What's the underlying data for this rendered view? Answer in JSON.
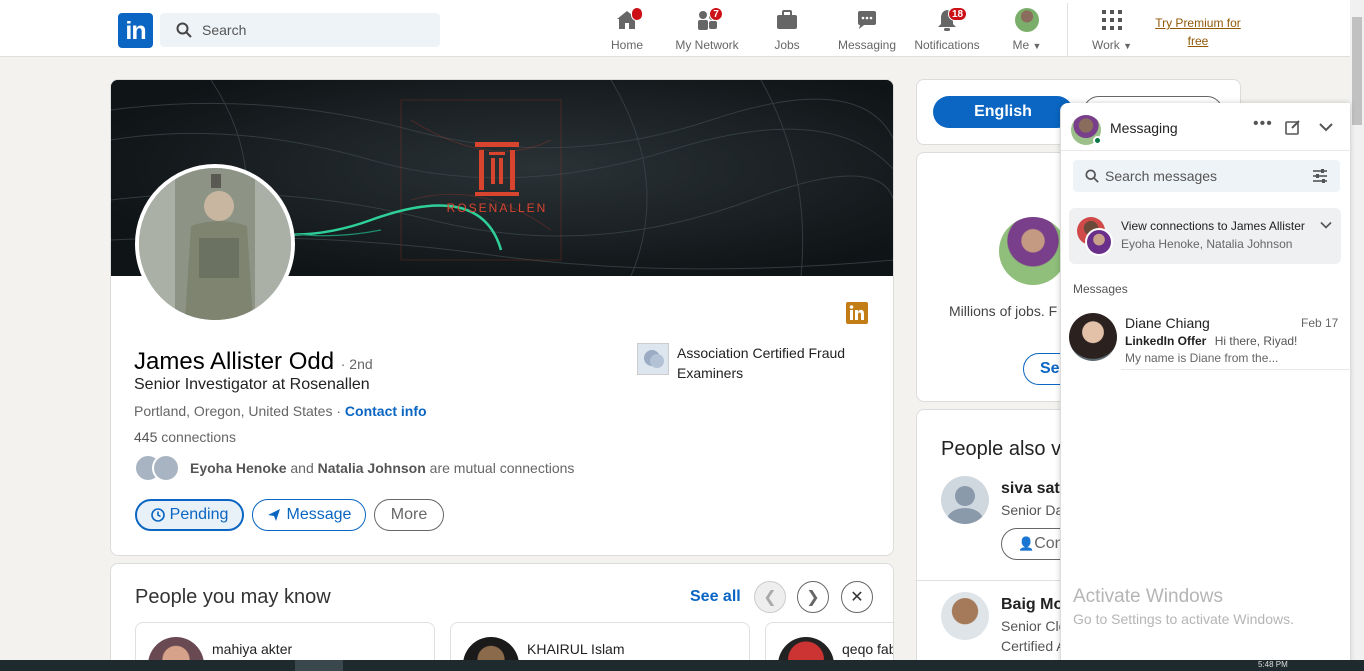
{
  "nav": {
    "search_placeholder": "Search",
    "items": [
      {
        "label": "Home",
        "badge": ""
      },
      {
        "label": "My Network",
        "badge": "7"
      },
      {
        "label": "Jobs",
        "badge": ""
      },
      {
        "label": "Messaging",
        "badge": ""
      },
      {
        "label": "Notifications",
        "badge": "18"
      },
      {
        "label": "Me",
        "badge": ""
      },
      {
        "label": "Work",
        "badge": ""
      }
    ],
    "premium_line1": "Try Premium for",
    "premium_line2": "free"
  },
  "profile": {
    "banner_text": "ROSENALLEN",
    "name": "James Allister Odd",
    "degree": "· 2nd",
    "headline": "Senior Investigator at Rosenallen",
    "location": "Portland, Oregon, United States",
    "location_sep": " · ",
    "contact_info": "Contact info",
    "connections_count": "445",
    "connections_label": " connections",
    "mutual_1": "Eyoha Henoke",
    "mutual_and": " and ",
    "mutual_2": "Natalia Johnson",
    "mutual_suffix": " are mutual connections",
    "school": "Association Certified Fraud Examiners",
    "buttons": {
      "pending": "Pending",
      "message": "Message",
      "more": "More"
    }
  },
  "pymk": {
    "title": "People you may know",
    "see_all": "See all",
    "people": [
      "mahiya akter",
      "KHAIRUL Islam",
      "qeqo fab"
    ]
  },
  "right": {
    "language": "English",
    "ad_text": "Millions of jobs. F",
    "ad_btn": "Sea",
    "pav_title": "People also vi",
    "pav": [
      {
        "name": "siva saty",
        "title": "Senior Da",
        "btn": "Con"
      },
      {
        "name": "Baig Mo",
        "title": "Senior Clo",
        "title2": "Certified A"
      }
    ]
  },
  "messaging": {
    "title": "Messaging",
    "search_placeholder": "Search messages",
    "view_conn_title": "View connections to James Allister",
    "view_conn_sub": "Eyoha Henoke, Natalia Johnson",
    "messages_label": "Messages",
    "convo": {
      "name": "Diane Chiang",
      "date": "Feb 17",
      "tag": "LinkedIn Offer",
      "preview1": "Hi there, Riyad!",
      "preview2": "My name is Diane from the..."
    }
  },
  "watermark": {
    "line1": "Activate Windows",
    "line2": "Go to Settings to activate Windows."
  },
  "taskbar": {
    "time": "5:48 PM"
  },
  "colors": {
    "brand": "#0a66c2",
    "badge": "#cc1016",
    "premium": "#915907"
  }
}
